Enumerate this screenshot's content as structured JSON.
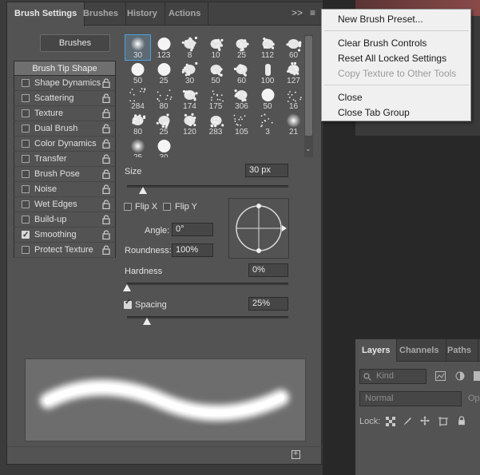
{
  "tabs": {
    "brush_settings": "Brush Settings",
    "brushes": "Brushes",
    "history": "History",
    "actions": "Actions",
    "collapse": ">>",
    "menu": "≡"
  },
  "brushes_button": "Brushes",
  "tip_shape": "Brush Tip Shape",
  "options": [
    {
      "label": "Shape Dynamics",
      "checked": false
    },
    {
      "label": "Scattering",
      "checked": false
    },
    {
      "label": "Texture",
      "checked": false
    },
    {
      "label": "Dual Brush",
      "checked": false
    },
    {
      "label": "Color Dynamics",
      "checked": false
    },
    {
      "label": "Transfer",
      "checked": false
    },
    {
      "label": "Brush Pose",
      "checked": false
    },
    {
      "label": "Noise",
      "checked": false
    },
    {
      "label": "Wet Edges",
      "checked": false
    },
    {
      "label": "Build-up",
      "checked": false
    },
    {
      "label": "Smoothing",
      "checked": true
    },
    {
      "label": "Protect Texture",
      "checked": false
    }
  ],
  "presets": [
    {
      "size": "30",
      "kind": "soft"
    },
    {
      "size": "123",
      "kind": "hard"
    },
    {
      "size": "8",
      "kind": "splat"
    },
    {
      "size": "10",
      "kind": "splat"
    },
    {
      "size": "25",
      "kind": "splat"
    },
    {
      "size": "112",
      "kind": "splat"
    },
    {
      "size": "60",
      "kind": "splat"
    },
    {
      "size": "50",
      "kind": "hard"
    },
    {
      "size": "25",
      "kind": "hard"
    },
    {
      "size": "30",
      "kind": "splat"
    },
    {
      "size": "50",
      "kind": "splat"
    },
    {
      "size": "60",
      "kind": "splat"
    },
    {
      "size": "100",
      "kind": "chalk"
    },
    {
      "size": "127",
      "kind": "splat"
    },
    {
      "size": "284",
      "kind": "dots"
    },
    {
      "size": "80",
      "kind": "dots"
    },
    {
      "size": "174",
      "kind": "splat"
    },
    {
      "size": "175",
      "kind": "dots"
    },
    {
      "size": "306",
      "kind": "splat"
    },
    {
      "size": "50",
      "kind": "hard"
    },
    {
      "size": "16",
      "kind": "dots"
    },
    {
      "size": "80",
      "kind": "splat"
    },
    {
      "size": "25",
      "kind": "splat"
    },
    {
      "size": "120",
      "kind": "splat"
    },
    {
      "size": "283",
      "kind": "splat"
    },
    {
      "size": "105",
      "kind": "dots"
    },
    {
      "size": "3",
      "kind": "dots"
    },
    {
      "size": "21",
      "kind": "soft"
    },
    {
      "size": "25",
      "kind": "soft"
    },
    {
      "size": "30",
      "kind": "hard"
    }
  ],
  "size": {
    "label": "Size",
    "value": "30 px",
    "level": 0.1
  },
  "flip_x": "Flip X",
  "flip_y": "Flip Y",
  "angle": {
    "label": "Angle:",
    "value": "0°"
  },
  "roundness": {
    "label": "Roundness:",
    "value": "100%"
  },
  "hardness": {
    "label": "Hardness",
    "value": "0%",
    "level": 0
  },
  "spacing": {
    "label": "Spacing",
    "value": "25%",
    "checked": true,
    "level": 0.125
  },
  "menu": {
    "items": [
      {
        "label": "New Brush Preset...",
        "disabled": false
      },
      {
        "label": "Clear Brush Controls",
        "disabled": false
      },
      {
        "label": "Reset All Locked Settings",
        "disabled": false
      },
      {
        "label": "Copy Texture to Other Tools",
        "disabled": true
      },
      {
        "label": "Close",
        "disabled": false
      },
      {
        "label": "Close Tab Group",
        "disabled": false
      }
    ]
  },
  "layers_panel": {
    "tabs": [
      "Layers",
      "Channels",
      "Paths"
    ],
    "kind_placeholder": "Kind",
    "blend_mode": "Normal",
    "opacity_label": "Op",
    "lock_label": "Lock:"
  },
  "colors": {
    "panel_bg": "#535353",
    "selection_blue": "#4aa3df",
    "menu_bg": "#f0f0f0"
  }
}
